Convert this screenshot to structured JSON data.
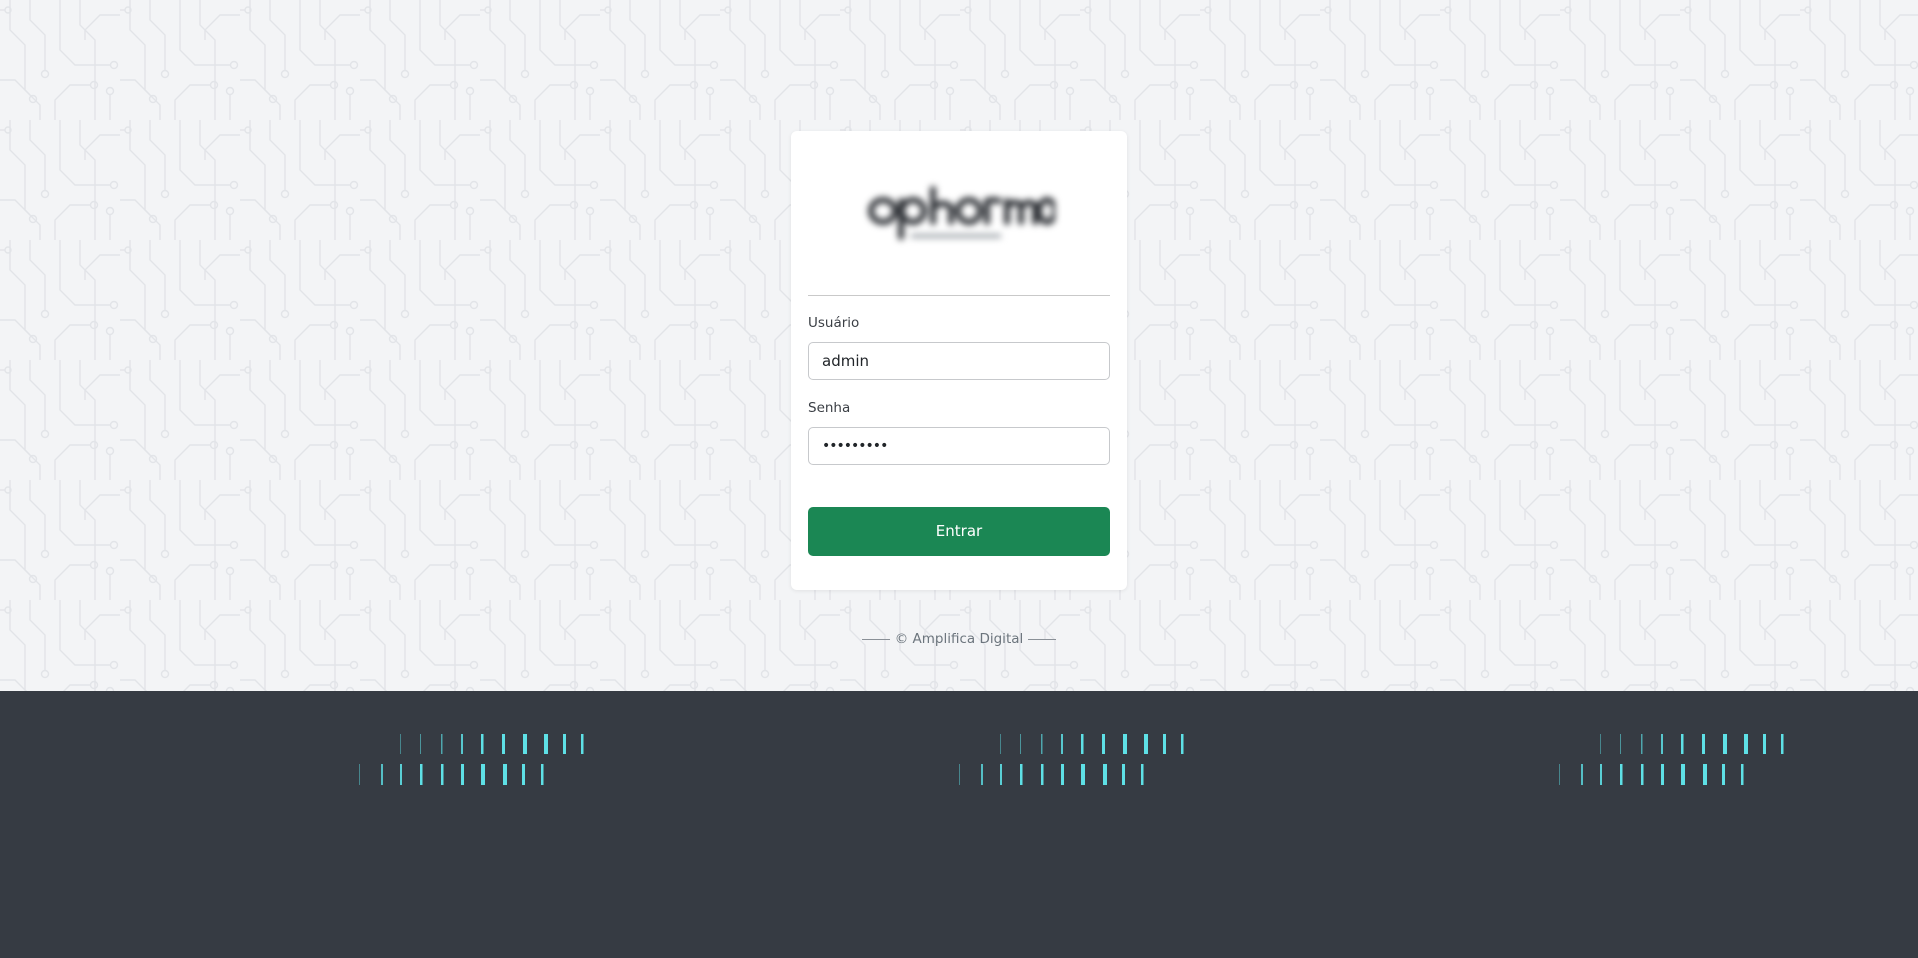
{
  "login": {
    "username_label": "Usuário",
    "username_value": "admin",
    "password_label": "Senha",
    "password_value": "•••••••••",
    "submit_label": "Entrar"
  },
  "footer": {
    "copyright": "© Amplifica Digital"
  },
  "logo": {
    "alt": "logo"
  },
  "colors": {
    "background": "#f3f4f6",
    "card": "#ffffff",
    "button": "#1b8754",
    "footer_band": "#363b43",
    "accent_bars": "#5ee0e6"
  }
}
